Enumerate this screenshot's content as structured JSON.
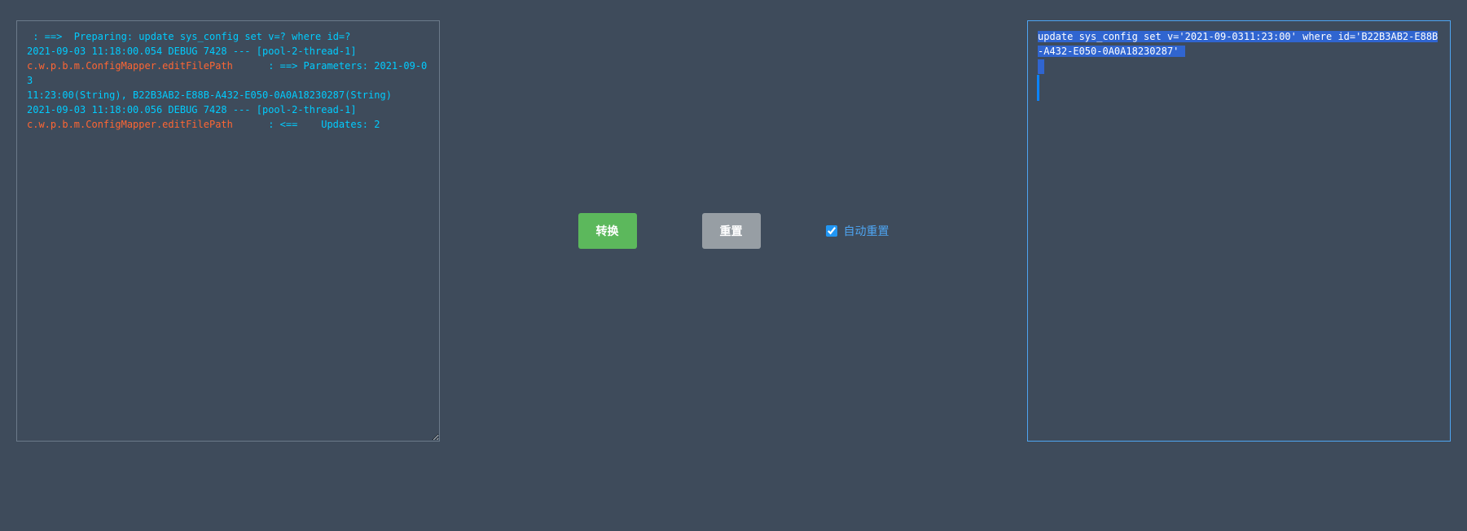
{
  "input": {
    "lines": [
      {
        "class": "log-cyan",
        "text": " : ==>  Preparing: update sys_config set v=? where id=?"
      },
      {
        "class": "log-cyan",
        "text": "2021-09-03 11:18:00.054 DEBUG 7428 --- [pool-2-thread-1]"
      },
      {
        "class": "log-orange",
        "text": "c.w.p.b.m.ConfigMapper.editFilePath      : ==> Parameters: 2021-09-03"
      },
      {
        "class": "log-cyan",
        "text": "11:23:00(String), B22B3AB2-E88B-A432-E050-0A0A18230287(String)"
      },
      {
        "class": "log-cyan",
        "text": "2021-09-03 11:18:00.056 DEBUG 7428 --- [pool-2-thread-1]"
      },
      {
        "class": "log-orange",
        "text": "c.w.p.b.m.ConfigMapper.editFilePath      : <==    Updates: 2"
      }
    ]
  },
  "buttons": {
    "convert": "转换",
    "reset": "重置"
  },
  "checkbox": {
    "checked": true,
    "label": "自动重置"
  },
  "output": {
    "text": "update sys_config set v='2021-09-0311:23:00' where id='B22B3AB2-E88B-A432-E050-0A0A18230287' "
  }
}
